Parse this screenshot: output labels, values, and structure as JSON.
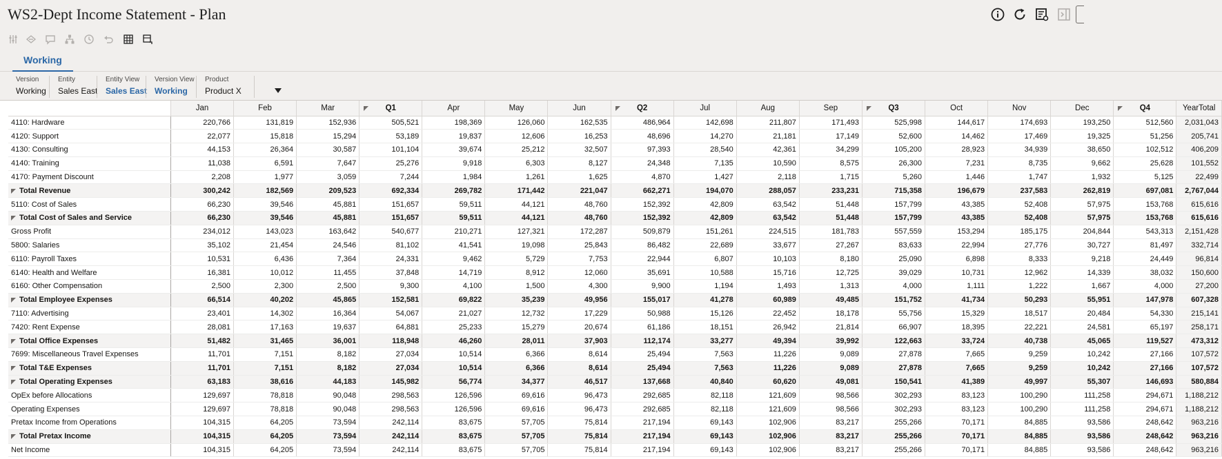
{
  "title": "WS2-Dept Income Statement - Plan",
  "title_icons": [
    "info-icon",
    "refresh-icon",
    "worksheet-settings-icon",
    "collapse-panel-icon"
  ],
  "toolbar_icons": [
    "adjust-icon",
    "spread-icon",
    "comment-icon",
    "hierarchy-icon",
    "history-icon",
    "undo-icon",
    "grid-select-icon",
    "open-panel-icon"
  ],
  "tab": {
    "label": "Working"
  },
  "pov": [
    {
      "label": "Version",
      "value": "Working",
      "link": false
    },
    {
      "label": "Entity",
      "value": "Sales East",
      "link": false
    },
    {
      "label": "Entity View",
      "value": "Sales East",
      "link": true
    },
    {
      "label": "Version View",
      "value": "Working",
      "link": true
    },
    {
      "label": "Product",
      "value": "Product X",
      "link": false
    }
  ],
  "grid": {
    "columns": [
      {
        "label": "Jan",
        "qtr": false
      },
      {
        "label": "Feb",
        "qtr": false
      },
      {
        "label": "Mar",
        "qtr": false
      },
      {
        "label": "Q1",
        "qtr": true
      },
      {
        "label": "Apr",
        "qtr": false
      },
      {
        "label": "May",
        "qtr": false
      },
      {
        "label": "Jun",
        "qtr": false
      },
      {
        "label": "Q2",
        "qtr": true
      },
      {
        "label": "Jul",
        "qtr": false
      },
      {
        "label": "Aug",
        "qtr": false
      },
      {
        "label": "Sep",
        "qtr": false
      },
      {
        "label": "Q3",
        "qtr": true
      },
      {
        "label": "Oct",
        "qtr": false
      },
      {
        "label": "Nov",
        "qtr": false
      },
      {
        "label": "Dec",
        "qtr": false
      },
      {
        "label": "Q4",
        "qtr": true
      },
      {
        "label": "YearTotal",
        "qtr": false
      }
    ],
    "rows": [
      {
        "label": "4110: Hardware",
        "indent": 2,
        "total": false,
        "expander": false,
        "values": [
          "220,766",
          "131,819",
          "152,936",
          "505,521",
          "198,369",
          "126,060",
          "162,535",
          "486,964",
          "142,698",
          "211,807",
          "171,493",
          "525,998",
          "144,617",
          "174,693",
          "193,250",
          "512,560",
          "2,031,043"
        ]
      },
      {
        "label": "4120: Support",
        "indent": 2,
        "total": false,
        "expander": false,
        "values": [
          "22,077",
          "15,818",
          "15,294",
          "53,189",
          "19,837",
          "12,606",
          "16,253",
          "48,696",
          "14,270",
          "21,181",
          "17,149",
          "52,600",
          "14,462",
          "17,469",
          "19,325",
          "51,256",
          "205,741"
        ]
      },
      {
        "label": "4130: Consulting",
        "indent": 2,
        "total": false,
        "expander": false,
        "values": [
          "44,153",
          "26,364",
          "30,587",
          "101,104",
          "39,674",
          "25,212",
          "32,507",
          "97,393",
          "28,540",
          "42,361",
          "34,299",
          "105,200",
          "28,923",
          "34,939",
          "38,650",
          "102,512",
          "406,209"
        ]
      },
      {
        "label": "4140: Training",
        "indent": 2,
        "total": false,
        "expander": false,
        "values": [
          "11,038",
          "6,591",
          "7,647",
          "25,276",
          "9,918",
          "6,303",
          "8,127",
          "24,348",
          "7,135",
          "10,590",
          "8,575",
          "26,300",
          "7,231",
          "8,735",
          "9,662",
          "25,628",
          "101,552"
        ]
      },
      {
        "label": "4170: Payment Discount",
        "indent": 2,
        "total": false,
        "expander": false,
        "values": [
          "2,208",
          "1,977",
          "3,059",
          "7,244",
          "1,984",
          "1,261",
          "1,625",
          "4,870",
          "1,427",
          "2,118",
          "1,715",
          "5,260",
          "1,446",
          "1,747",
          "1,932",
          "5,125",
          "22,499"
        ]
      },
      {
        "label": "Total Revenue",
        "indent": 1,
        "total": true,
        "expander": true,
        "values": [
          "300,242",
          "182,569",
          "209,523",
          "692,334",
          "269,782",
          "171,442",
          "221,047",
          "662,271",
          "194,070",
          "288,057",
          "233,231",
          "715,358",
          "196,679",
          "237,583",
          "262,819",
          "697,081",
          "2,767,044"
        ]
      },
      {
        "label": "5110: Cost of Sales",
        "indent": 2,
        "total": false,
        "expander": false,
        "values": [
          "66,230",
          "39,546",
          "45,881",
          "151,657",
          "59,511",
          "44,121",
          "48,760",
          "152,392",
          "42,809",
          "63,542",
          "51,448",
          "157,799",
          "43,385",
          "52,408",
          "57,975",
          "153,768",
          "615,616"
        ]
      },
      {
        "label": "Total Cost of Sales and Service",
        "indent": 1,
        "total": true,
        "expander": true,
        "values": [
          "66,230",
          "39,546",
          "45,881",
          "151,657",
          "59,511",
          "44,121",
          "48,760",
          "152,392",
          "42,809",
          "63,542",
          "51,448",
          "157,799",
          "43,385",
          "52,408",
          "57,975",
          "153,768",
          "615,616"
        ]
      },
      {
        "label": "Gross Profit",
        "indent": 1,
        "total": false,
        "expander": false,
        "values": [
          "234,012",
          "143,023",
          "163,642",
          "540,677",
          "210,271",
          "127,321",
          "172,287",
          "509,879",
          "151,261",
          "224,515",
          "181,783",
          "557,559",
          "153,294",
          "185,175",
          "204,844",
          "543,313",
          "2,151,428"
        ]
      },
      {
        "label": "5800: Salaries",
        "indent": 2,
        "total": false,
        "expander": false,
        "values": [
          "35,102",
          "21,454",
          "24,546",
          "81,102",
          "41,541",
          "19,098",
          "25,843",
          "86,482",
          "22,689",
          "33,677",
          "27,267",
          "83,633",
          "22,994",
          "27,776",
          "30,727",
          "81,497",
          "332,714"
        ]
      },
      {
        "label": "6110: Payroll Taxes",
        "indent": 2,
        "total": false,
        "expander": false,
        "values": [
          "10,531",
          "6,436",
          "7,364",
          "24,331",
          "9,462",
          "5,729",
          "7,753",
          "22,944",
          "6,807",
          "10,103",
          "8,180",
          "25,090",
          "6,898",
          "8,333",
          "9,218",
          "24,449",
          "96,814"
        ]
      },
      {
        "label": "6140: Health and Welfare",
        "indent": 2,
        "total": false,
        "expander": false,
        "values": [
          "16,381",
          "10,012",
          "11,455",
          "37,848",
          "14,719",
          "8,912",
          "12,060",
          "35,691",
          "10,588",
          "15,716",
          "12,725",
          "39,029",
          "10,731",
          "12,962",
          "14,339",
          "38,032",
          "150,600"
        ]
      },
      {
        "label": "6160: Other Compensation",
        "indent": 2,
        "total": false,
        "expander": false,
        "values": [
          "2,500",
          "2,300",
          "2,500",
          "9,300",
          "4,100",
          "1,500",
          "4,300",
          "9,900",
          "1,194",
          "1,493",
          "1,313",
          "4,000",
          "1,111",
          "1,222",
          "1,667",
          "4,000",
          "27,200"
        ]
      },
      {
        "label": "Total Employee Expenses",
        "indent": 1,
        "total": true,
        "expander": true,
        "values": [
          "66,514",
          "40,202",
          "45,865",
          "152,581",
          "69,822",
          "35,239",
          "49,956",
          "155,017",
          "41,278",
          "60,989",
          "49,485",
          "151,752",
          "41,734",
          "50,293",
          "55,951",
          "147,978",
          "607,328"
        ]
      },
      {
        "label": "7110: Advertising",
        "indent": 3,
        "total": false,
        "expander": false,
        "values": [
          "23,401",
          "14,302",
          "16,364",
          "54,067",
          "21,027",
          "12,732",
          "17,229",
          "50,988",
          "15,126",
          "22,452",
          "18,178",
          "55,756",
          "15,329",
          "18,517",
          "20,484",
          "54,330",
          "215,141"
        ]
      },
      {
        "label": "7420: Rent Expense",
        "indent": 3,
        "total": false,
        "expander": false,
        "values": [
          "28,081",
          "17,163",
          "19,637",
          "64,881",
          "25,233",
          "15,279",
          "20,674",
          "61,186",
          "18,151",
          "26,942",
          "21,814",
          "66,907",
          "18,395",
          "22,221",
          "24,581",
          "65,197",
          "258,171"
        ]
      },
      {
        "label": "Total Office Expenses",
        "indent": 2,
        "total": true,
        "expander": true,
        "values": [
          "51,482",
          "31,465",
          "36,001",
          "118,948",
          "46,260",
          "28,011",
          "37,903",
          "112,174",
          "33,277",
          "49,394",
          "39,992",
          "122,663",
          "33,724",
          "40,738",
          "45,065",
          "119,527",
          "473,312"
        ]
      },
      {
        "label": "7699: Miscellaneous Travel Expenses",
        "indent": 3,
        "total": false,
        "expander": false,
        "values": [
          "11,701",
          "7,151",
          "8,182",
          "27,034",
          "10,514",
          "6,366",
          "8,614",
          "25,494",
          "7,563",
          "11,226",
          "9,089",
          "27,878",
          "7,665",
          "9,259",
          "10,242",
          "27,166",
          "107,572"
        ]
      },
      {
        "label": "Total T&E Expenses",
        "indent": 2,
        "total": true,
        "expander": true,
        "values": [
          "11,701",
          "7,151",
          "8,182",
          "27,034",
          "10,514",
          "6,366",
          "8,614",
          "25,494",
          "7,563",
          "11,226",
          "9,089",
          "27,878",
          "7,665",
          "9,259",
          "10,242",
          "27,166",
          "107,572"
        ]
      },
      {
        "label": "Total Operating Expenses",
        "indent": 1,
        "total": true,
        "expander": true,
        "values": [
          "63,183",
          "38,616",
          "44,183",
          "145,982",
          "56,774",
          "34,377",
          "46,517",
          "137,668",
          "40,840",
          "60,620",
          "49,081",
          "150,541",
          "41,389",
          "49,997",
          "55,307",
          "146,693",
          "580,884"
        ]
      },
      {
        "label": "OpEx before Allocations",
        "indent": 1,
        "total": false,
        "expander": false,
        "values": [
          "129,697",
          "78,818",
          "90,048",
          "298,563",
          "126,596",
          "69,616",
          "96,473",
          "292,685",
          "82,118",
          "121,609",
          "98,566",
          "302,293",
          "83,123",
          "100,290",
          "111,258",
          "294,671",
          "1,188,212"
        ]
      },
      {
        "label": "Operating Expenses",
        "indent": 1,
        "total": false,
        "expander": false,
        "values": [
          "129,697",
          "78,818",
          "90,048",
          "298,563",
          "126,596",
          "69,616",
          "96,473",
          "292,685",
          "82,118",
          "121,609",
          "98,566",
          "302,293",
          "83,123",
          "100,290",
          "111,258",
          "294,671",
          "1,188,212"
        ]
      },
      {
        "label": "Pretax Income from Operations",
        "indent": 2,
        "total": false,
        "expander": false,
        "values": [
          "104,315",
          "64,205",
          "73,594",
          "242,114",
          "83,675",
          "57,705",
          "75,814",
          "217,194",
          "69,143",
          "102,906",
          "83,217",
          "255,266",
          "70,171",
          "84,885",
          "93,586",
          "248,642",
          "963,216"
        ]
      },
      {
        "label": "Total Pretax Income",
        "indent": 1,
        "total": true,
        "expander": true,
        "values": [
          "104,315",
          "64,205",
          "73,594",
          "242,114",
          "83,675",
          "57,705",
          "75,814",
          "217,194",
          "69,143",
          "102,906",
          "83,217",
          "255,266",
          "70,171",
          "84,885",
          "93,586",
          "248,642",
          "963,216"
        ]
      },
      {
        "label": "Net Income",
        "indent": 1,
        "total": false,
        "expander": false,
        "values": [
          "104,315",
          "64,205",
          "73,594",
          "242,114",
          "83,675",
          "57,705",
          "75,814",
          "217,194",
          "69,143",
          "102,906",
          "83,217",
          "255,266",
          "70,171",
          "84,885",
          "93,586",
          "248,642",
          "963,216"
        ]
      }
    ]
  }
}
